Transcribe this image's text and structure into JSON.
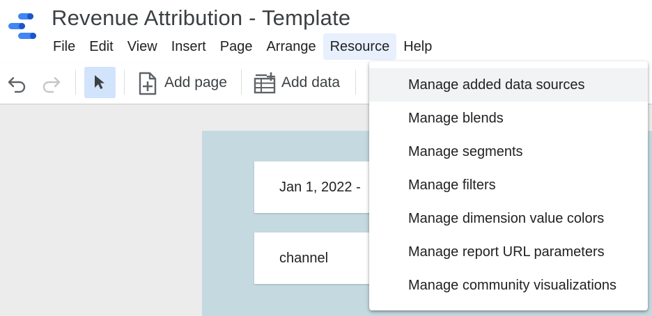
{
  "app": {
    "title": "Revenue Attribution - Template"
  },
  "menubar": {
    "items": [
      "File",
      "Edit",
      "View",
      "Insert",
      "Page",
      "Arrange",
      "Resource",
      "Help"
    ],
    "active": "Resource"
  },
  "toolbar": {
    "undo_icon": "undo-icon",
    "redo_icon": "redo-icon",
    "select_icon": "cursor-arrow-icon",
    "add_page_label": "Add page",
    "add_data_label": "Add data"
  },
  "canvas": {
    "date_range_text": "Jan 1, 2022 -",
    "channel_text": "channel"
  },
  "resource_menu": {
    "items": [
      "Manage added data sources",
      "Manage blends",
      "Manage segments",
      "Manage filters",
      "Manage dimension value colors",
      "Manage report URL parameters",
      "Manage community visualizations"
    ],
    "hovered_index": 0
  },
  "colors": {
    "logo_blue": "#4285f4",
    "logo_dark_blue": "#1a56c9",
    "active_menu_bg": "#e8f0fe",
    "select_tool_bg": "#d2e3fc",
    "report_background": "#c5d9e0"
  }
}
